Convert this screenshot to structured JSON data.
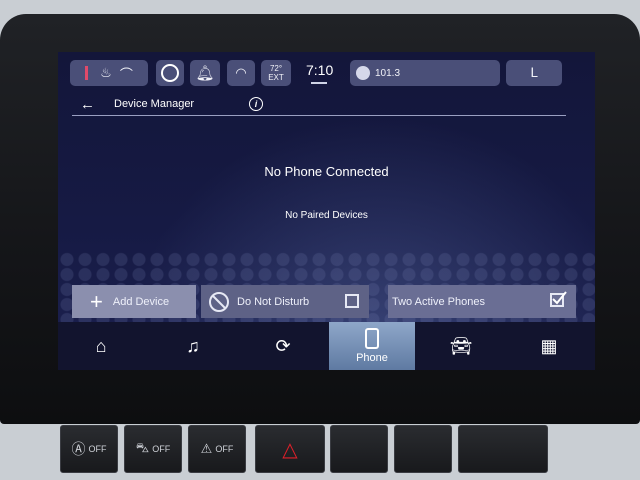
{
  "status_bar": {
    "temp_display": "72°\nEXT",
    "clock": "7:10",
    "radio_station": "101.3"
  },
  "header": {
    "title": "Device Manager"
  },
  "main": {
    "message_primary": "No Phone Connected",
    "message_secondary": "No Paired Devices"
  },
  "actions": {
    "add_device": "Add Device",
    "do_not_disturb": "Do Not Disturb",
    "two_active_phones": "Two Active Phones",
    "do_not_disturb_checked": false,
    "two_active_phones_checked": true
  },
  "nav": {
    "phone_label": "Phone",
    "items": [
      "home-icon",
      "music-icon",
      "apps-swirl-icon",
      "phone-icon",
      "car-icon",
      "grid-icon"
    ]
  },
  "hardware": {
    "auto_off": "OFF",
    "traction_off": "OFF",
    "stability_off": "OFF"
  },
  "colors": {
    "screen_bg": "#161a44",
    "nav_active": "#7d97bd",
    "hazard": "#e0202a"
  }
}
